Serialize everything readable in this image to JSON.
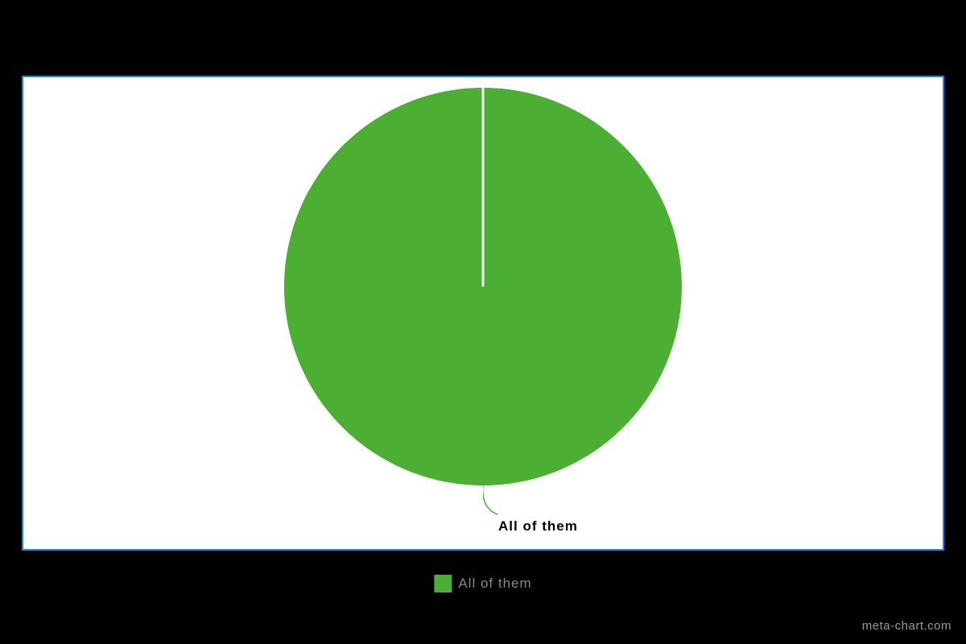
{
  "chart_data": {
    "type": "pie",
    "series": [
      {
        "name": "All of them",
        "value": 100,
        "color": "#4caf34"
      }
    ],
    "title": "",
    "legend": {
      "position": "bottom",
      "items": [
        "All of them"
      ]
    }
  },
  "colors": {
    "slice": "#4caf34",
    "border": "#1e88e5",
    "page_bg": "#000000",
    "panel_bg": "#ffffff"
  },
  "labels": {
    "slice": "All of them",
    "legend": "All of them"
  },
  "watermark": "meta-chart.com"
}
